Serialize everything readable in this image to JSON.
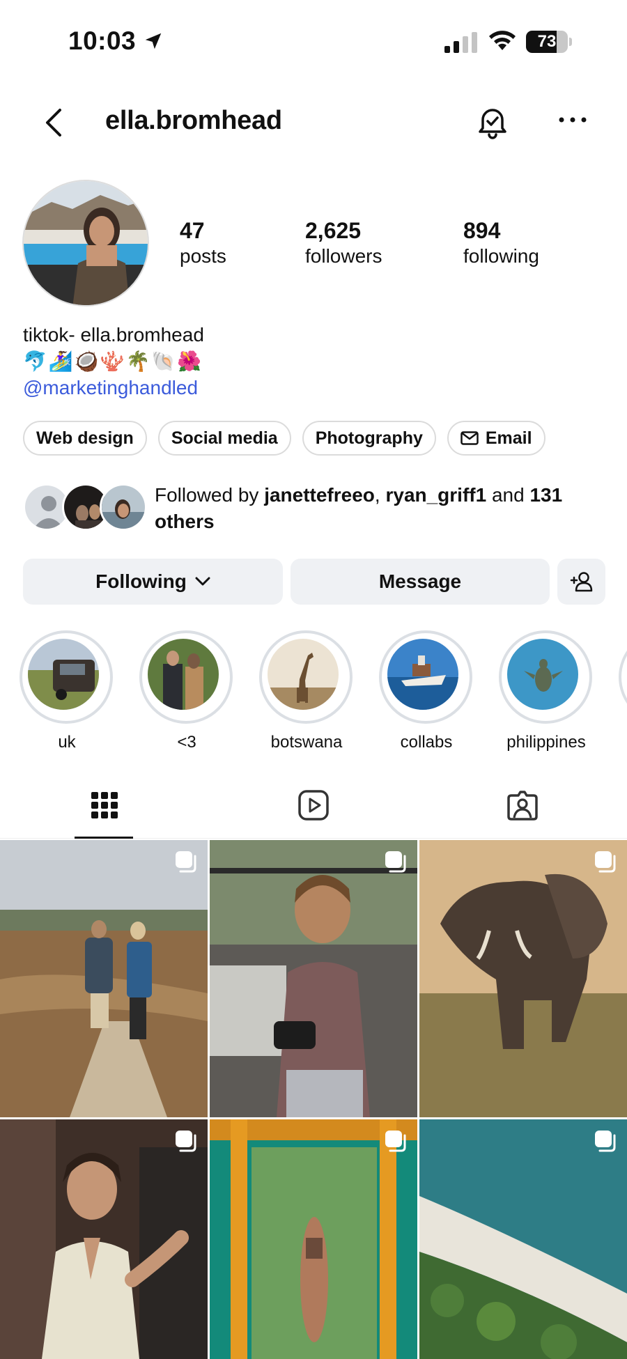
{
  "status_bar": {
    "time": "10:03",
    "battery": "73"
  },
  "header": {
    "username": "ella.bromhead"
  },
  "stats": [
    {
      "count": "47",
      "label": "posts"
    },
    {
      "count": "2,625",
      "label": "followers"
    },
    {
      "count": "894",
      "label": "following"
    }
  ],
  "bio": {
    "line1": "tiktok- ella.bromhead",
    "emojis": "🐬🏄‍♀️🥥🪸🌴🐚🌺",
    "link": "@marketinghandled"
  },
  "chips": [
    "Web design",
    "Social media",
    "Photography",
    "Email"
  ],
  "followed_by": {
    "prefix": "Followed by ",
    "user1": "janettefreeo",
    "sep": ", ",
    "user2": "ryan_griff1",
    "middle": " and ",
    "count": "131",
    "suffix": "others"
  },
  "actions": {
    "following": "Following",
    "message": "Message"
  },
  "highlights": [
    {
      "label": "uk"
    },
    {
      "label": "<3"
    },
    {
      "label": "botswana"
    },
    {
      "label": "collabs"
    },
    {
      "label": "philippines"
    }
  ],
  "colors": {
    "link": "#3b5bdb",
    "button_bg": "#eff1f4",
    "chip_border": "#dbdbdb",
    "ring": "#dbdfe4"
  }
}
